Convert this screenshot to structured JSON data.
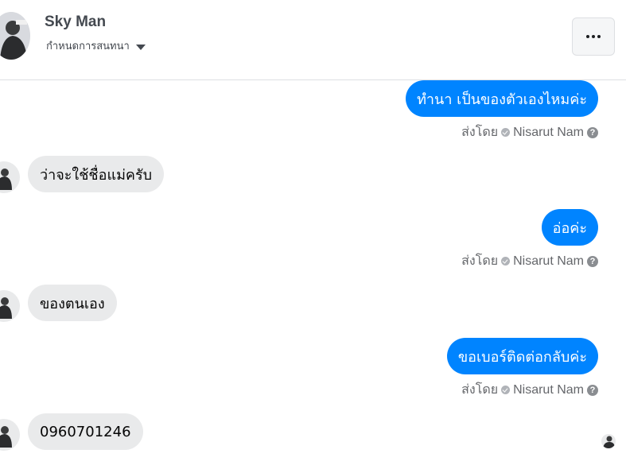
{
  "header": {
    "name": "Sky Man",
    "subtitle": "กำหนดการสนทนา"
  },
  "messages": [
    {
      "direction": "out",
      "text": "ทำนา เป็นของตัวเองไหมค่ะ",
      "sent_prefix": "ส่งโดย",
      "sender": "Nisarut Nam"
    },
    {
      "direction": "in",
      "text": "ว่าจะใช้ชื่อแม่ครับ"
    },
    {
      "direction": "out",
      "text": "อ่อค่ะ",
      "sent_prefix": "ส่งโดย",
      "sender": "Nisarut Nam"
    },
    {
      "direction": "in",
      "text": "ของตนเอง"
    },
    {
      "direction": "out",
      "text": "ขอเบอร์ติดต่อกลับค่ะ",
      "sent_prefix": "ส่งโดย",
      "sender": "Nisarut Nam"
    },
    {
      "direction": "in",
      "text": "0960701246"
    }
  ],
  "icons": {
    "more": "more-horizontal-icon",
    "caret": "caret-down-icon",
    "check": "check-circle-icon",
    "help": "question-circle-icon"
  },
  "colors": {
    "outgoing_bubble": "#0084ff",
    "incoming_bubble": "#e9eaeb"
  }
}
